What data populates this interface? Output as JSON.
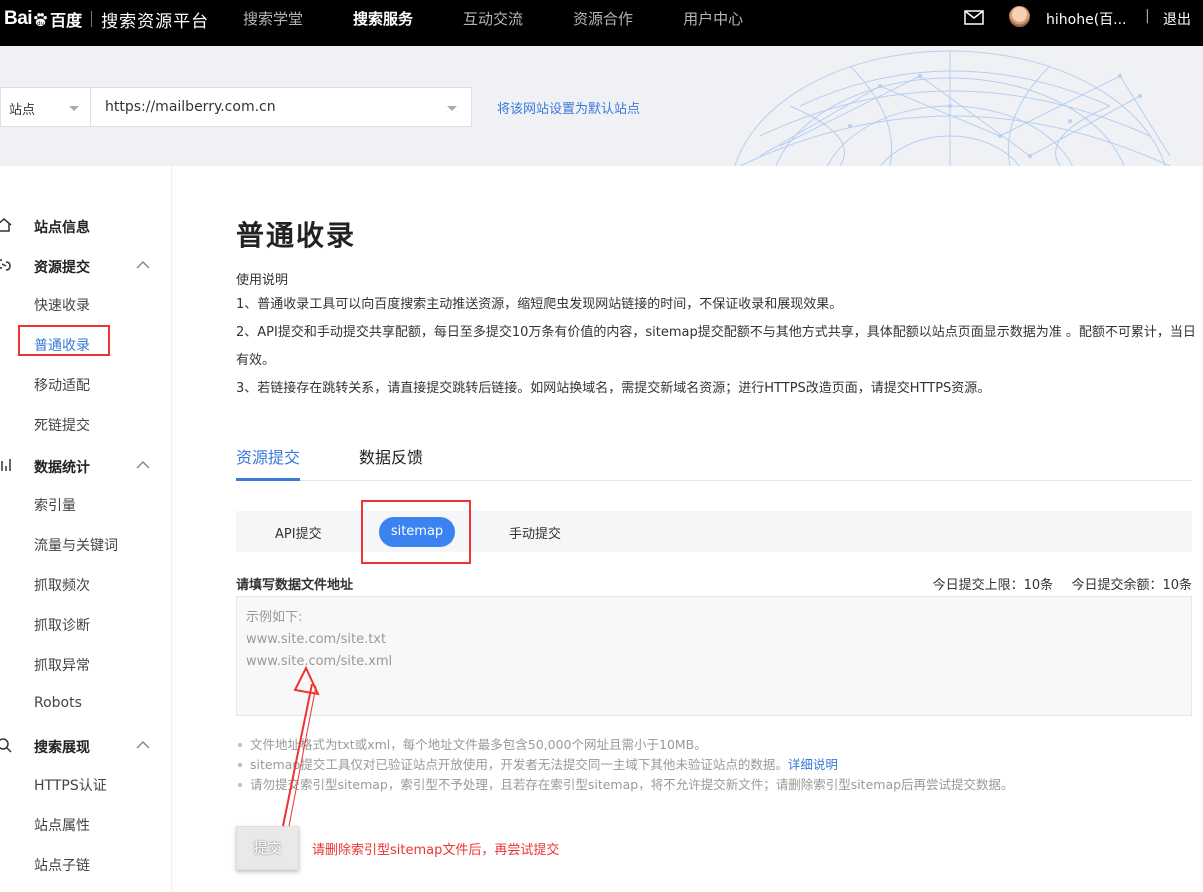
{
  "header": {
    "logo_mark": "Bai",
    "logo_cn": "百度",
    "platform_name": "搜索资源平台",
    "nav": [
      {
        "label": "搜索学堂",
        "active": false
      },
      {
        "label": "搜索服务",
        "active": true
      },
      {
        "label": "互动交流",
        "active": false
      },
      {
        "label": "资源合作",
        "active": false
      },
      {
        "label": "用户中心",
        "active": false
      }
    ],
    "user_name": "hihohe(百...",
    "separator": "|",
    "logout_label": "退出"
  },
  "sitebar": {
    "site_type": "站点",
    "site_url": "https://mailberry.com.cn",
    "set_default_link": "将该网站设置为默认站点"
  },
  "sidebar": {
    "groups": [
      {
        "label": "站点信息",
        "icon": "home-icon"
      },
      {
        "label": "资源提交",
        "icon": "link-icon",
        "items": [
          "快速收录",
          "普通收录",
          "移动适配",
          "死链提交"
        ]
      },
      {
        "label": "数据统计",
        "icon": "chart-icon",
        "items": [
          "索引量",
          "流量与关键词",
          "抓取频次",
          "抓取诊断",
          "抓取异常",
          "Robots"
        ]
      },
      {
        "label": "搜索展现",
        "icon": "search-icon",
        "items": [
          "HTTPS认证",
          "站点属性",
          "站点子链"
        ]
      }
    ],
    "active_item": "普通收录"
  },
  "main": {
    "title": "普通收录",
    "usage_title": "使用说明",
    "usage_lines": [
      "1、普通收录工具可以向百度搜索主动推送资源，缩短爬虫发现网站链接的时间，不保证收录和展现效果。",
      "2、API提交和手动提交共享配额，每日至多提交10万条有价值的内容，sitemap提交配额不与其他方式共享，具体配额以站点页面显示数据为准 。配额不可累计，当日有效。",
      "3、若链接存在跳转关系，请直接提交跳转后链接。如网站换域名，需提交新域名资源；进行HTTPS改造页面，请提交HTTPS资源。"
    ],
    "tabs": [
      {
        "label": "资源提交",
        "active": true
      },
      {
        "label": "数据反馈",
        "active": false
      }
    ],
    "subtabs": [
      {
        "label": "API提交",
        "active": false
      },
      {
        "label": "sitemap",
        "active": true
      },
      {
        "label": "手动提交",
        "active": false
      }
    ],
    "field_label": "请填写数据文件地址",
    "quota_limit": "今日提交上限：10条",
    "quota_remaining": "今日提交余额：10条",
    "textarea_placeholder_lines": [
      "示例如下:",
      "www.site.com/site.txt",
      "www.site.com/site.xml"
    ],
    "tips": {
      "tip1": "文件地址格式为txt或xml，每个地址文件最多包含50,000个网址且需小于10MB。",
      "tip2": "sitemap提交工具仅对已验证站点开放使用，开发者无法提交同一主域下其他未验证站点的数据。",
      "tip2_link": "详细说明",
      "tip3": "请勿提交索引型sitemap，索引型不予处理，且若存在索引型sitemap，将不允许提交新文件；请删除索引型sitemap后再尝试提交数据。"
    },
    "submit_label": "提交",
    "annotation_note": "请删除索引型sitemap文件后，再尝试提交"
  },
  "colors": {
    "accent": "#3a79d9",
    "pill": "#3a83f0",
    "annotation_red": "#e33333",
    "topbar": "#000000"
  }
}
